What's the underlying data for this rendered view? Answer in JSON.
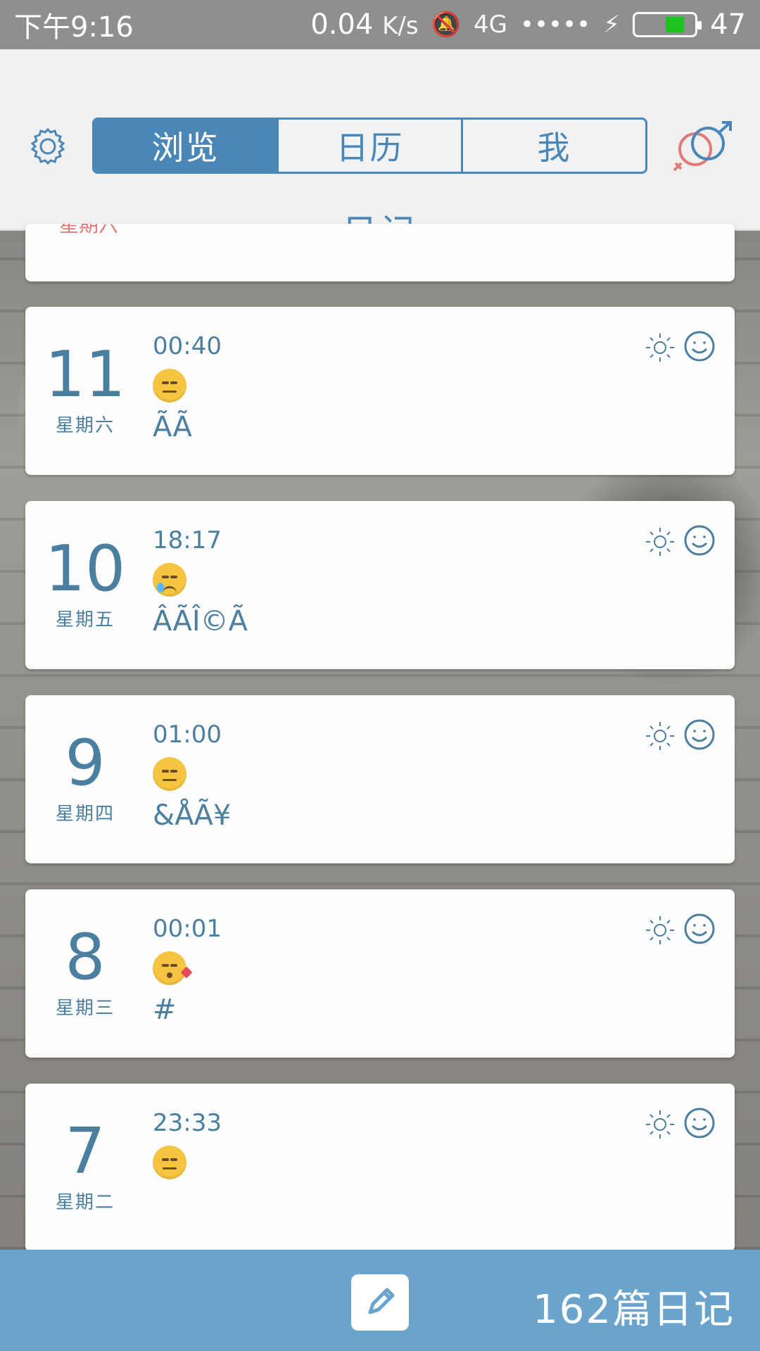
{
  "statusbar": {
    "time": "下午9:16",
    "speed": "0.04",
    "speed_unit": "K/s",
    "network": "4G",
    "battery_level": "47"
  },
  "header": {
    "tabs": [
      {
        "label": "浏览"
      },
      {
        "label": "日历"
      },
      {
        "label": "我"
      }
    ],
    "title": "日记"
  },
  "partial_card": {
    "weekday": "星期六"
  },
  "entries": [
    {
      "day": "11",
      "weekday": "星期六",
      "time": "00:40",
      "mood": "unamused-face",
      "content": "ÃÃ"
    },
    {
      "day": "10",
      "weekday": "星期五",
      "time": "18:17",
      "mood": "sad-tear-face",
      "content": "ÂÃÎ©Ã"
    },
    {
      "day": "9",
      "weekday": "星期四",
      "time": "01:00",
      "mood": "neutral-face",
      "content": "&ÅÃ¥"
    },
    {
      "day": "8",
      "weekday": "星期三",
      "time": "00:01",
      "mood": "kiss-heart-face",
      "content": "#"
    },
    {
      "day": "7",
      "weekday": "星期二",
      "time": "23:33",
      "mood": "unamused-face",
      "content": ""
    }
  ],
  "bottombar": {
    "count_label": "162篇日记"
  },
  "colors": {
    "accent": "#4a86b6",
    "text": "#4a7f9f",
    "bottombar": "#6aa4cd",
    "header_bg": "#f0f0f0"
  }
}
